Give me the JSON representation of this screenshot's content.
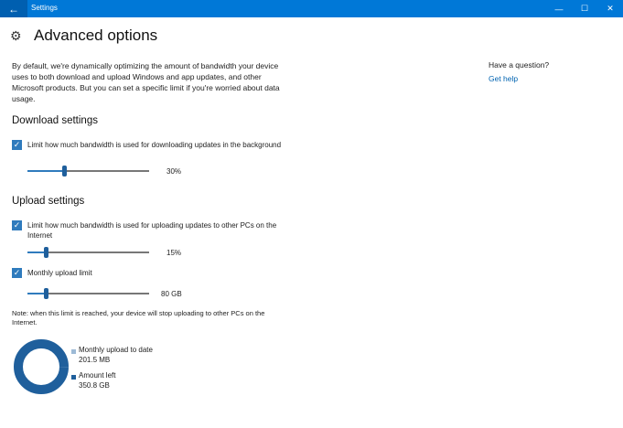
{
  "window": {
    "title": "Settings",
    "back_icon": "back-arrow-icon",
    "minimize_glyph": "—",
    "maximize_glyph": "☐",
    "close_glyph": "✕",
    "accent": "#0078d7"
  },
  "page": {
    "icon": "gear-icon",
    "title": "Advanced options",
    "description": "By default, we're dynamically optimizing the amount of bandwidth your device uses to both download and upload Windows and app updates, and other Microsoft products. But you can set a specific limit if you're worried about data usage."
  },
  "download": {
    "title": "Download settings",
    "limit_checkbox": {
      "checked": true,
      "label": "Limit how much bandwidth is used for downloading updates in the background"
    },
    "slider": {
      "value_percent": 30,
      "display": "30%"
    }
  },
  "upload": {
    "title": "Upload settings",
    "limit_checkbox": {
      "checked": true,
      "label": "Limit how much bandwidth is used for uploading updates to other PCs on the Internet"
    },
    "slider": {
      "value_percent": 15,
      "display": "15%"
    },
    "monthly_checkbox": {
      "checked": true,
      "label": "Monthly upload limit"
    },
    "monthly_slider": {
      "value_fraction": 0.15,
      "display": "80 GB"
    },
    "note": "Note: when this limit is reached, your device will stop uploading to other PCs on the Internet."
  },
  "usage": {
    "uploaded_label": "Monthly upload to date",
    "uploaded_value": "201.5 MB",
    "uploaded_color": "#9dbad6",
    "left_label": "Amount left",
    "left_value": "350.8 GB",
    "left_color": "#1f5f9c"
  },
  "aside": {
    "question": "Have a question?",
    "help_link": "Get help"
  }
}
